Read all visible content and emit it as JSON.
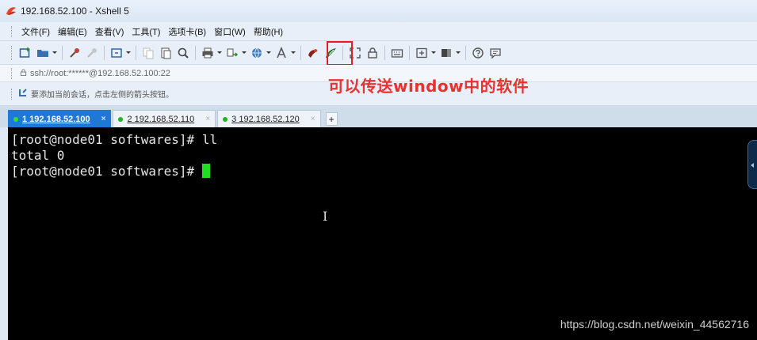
{
  "window": {
    "title": "192.168.52.100 - Xshell 5",
    "app_icon": "xshell-logo-icon"
  },
  "menu": {
    "items": [
      {
        "label": "文件(F)"
      },
      {
        "label": "编辑(E)"
      },
      {
        "label": "查看(V)"
      },
      {
        "label": "工具(T)"
      },
      {
        "label": "选项卡(B)"
      },
      {
        "label": "窗口(W)"
      },
      {
        "label": "帮助(H)"
      }
    ]
  },
  "toolbar": {
    "highlighted_tool": "transfer-file-icon",
    "highlight_color": "#e02020"
  },
  "address": {
    "icon": "lock-icon",
    "text": "ssh://root:******@192.168.52.100:22"
  },
  "hint": {
    "icon": "arrow-hint-icon",
    "text": "要添加当前会话，点击左侧的箭头按钮。"
  },
  "annotation": {
    "text": "可以传送window中的软件",
    "color": "#e8322f"
  },
  "tabs": [
    {
      "label": "1 192.168.52.100",
      "active": true,
      "close": "×"
    },
    {
      "label": "2 192.168.52.110",
      "active": false,
      "close": "×"
    },
    {
      "label": "3 192.168.52.120",
      "active": false,
      "close": "×"
    }
  ],
  "tab_add_label": "+",
  "terminal": {
    "lines": [
      "[root@node01 softwares]# ll",
      "total 0",
      "[root@node01 softwares]# "
    ],
    "cursor_color": "#22dd22",
    "background": "#000000"
  },
  "watermark": "https://blog.csdn.net/weixin_44562716"
}
